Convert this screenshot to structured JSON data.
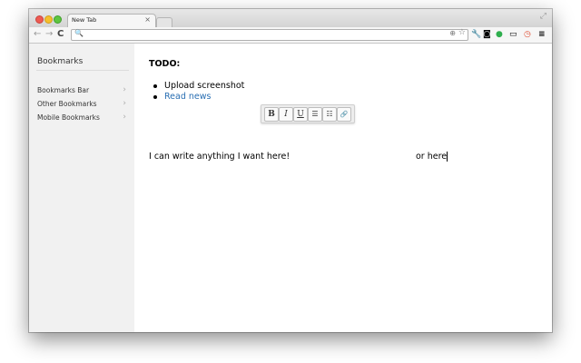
{
  "browser": {
    "tab_title": "New Tab",
    "tab_close": "×",
    "fullscreen_glyph": "⤢",
    "nav": {
      "back": "←",
      "forward": "→",
      "reload": "C"
    },
    "omnibox": {
      "value": "",
      "search_glyph": "🔍",
      "zoom_glyph": "⊕",
      "star_glyph": "☆"
    },
    "extensions": [
      {
        "name": "wrench-icon",
        "glyph": "🔧",
        "color": "#333333"
      },
      {
        "name": "pocket-icon",
        "glyph": "◙",
        "color": "#444444"
      },
      {
        "name": "hangouts-icon",
        "glyph": "●",
        "color": "#2fae4e"
      },
      {
        "name": "cast-icon",
        "glyph": "▭",
        "color": "#555555"
      },
      {
        "name": "timer-icon",
        "glyph": "◷",
        "color": "#e0533a"
      },
      {
        "name": "menu-icon",
        "glyph": "≡",
        "color": "#333333"
      }
    ]
  },
  "sidebar": {
    "title": "Bookmarks",
    "items": [
      {
        "label": "Bookmarks Bar",
        "chevron": "›"
      },
      {
        "label": "Other Bookmarks",
        "chevron": "›"
      },
      {
        "label": "Mobile Bookmarks",
        "chevron": "›"
      }
    ]
  },
  "content": {
    "heading": "TODO:",
    "todo_items": [
      {
        "label": "Upload screenshot",
        "is_link": false
      },
      {
        "label": "Read news",
        "is_link": true
      }
    ],
    "format_toolbar": [
      {
        "name": "bold-button",
        "glyph": "B"
      },
      {
        "name": "italic-button",
        "glyph": "I"
      },
      {
        "name": "underline-button",
        "glyph": "U"
      },
      {
        "name": "bullet-list-button",
        "glyph": "☰"
      },
      {
        "name": "numbered-list-button",
        "glyph": "☷"
      },
      {
        "name": "link-button",
        "glyph": "🔗"
      }
    ],
    "text_line_1": "I can write anything I want here!",
    "text_line_2": "or here"
  },
  "colors": {
    "link": "#2a6fb3",
    "sidebar_bg": "#f1f1f1"
  }
}
